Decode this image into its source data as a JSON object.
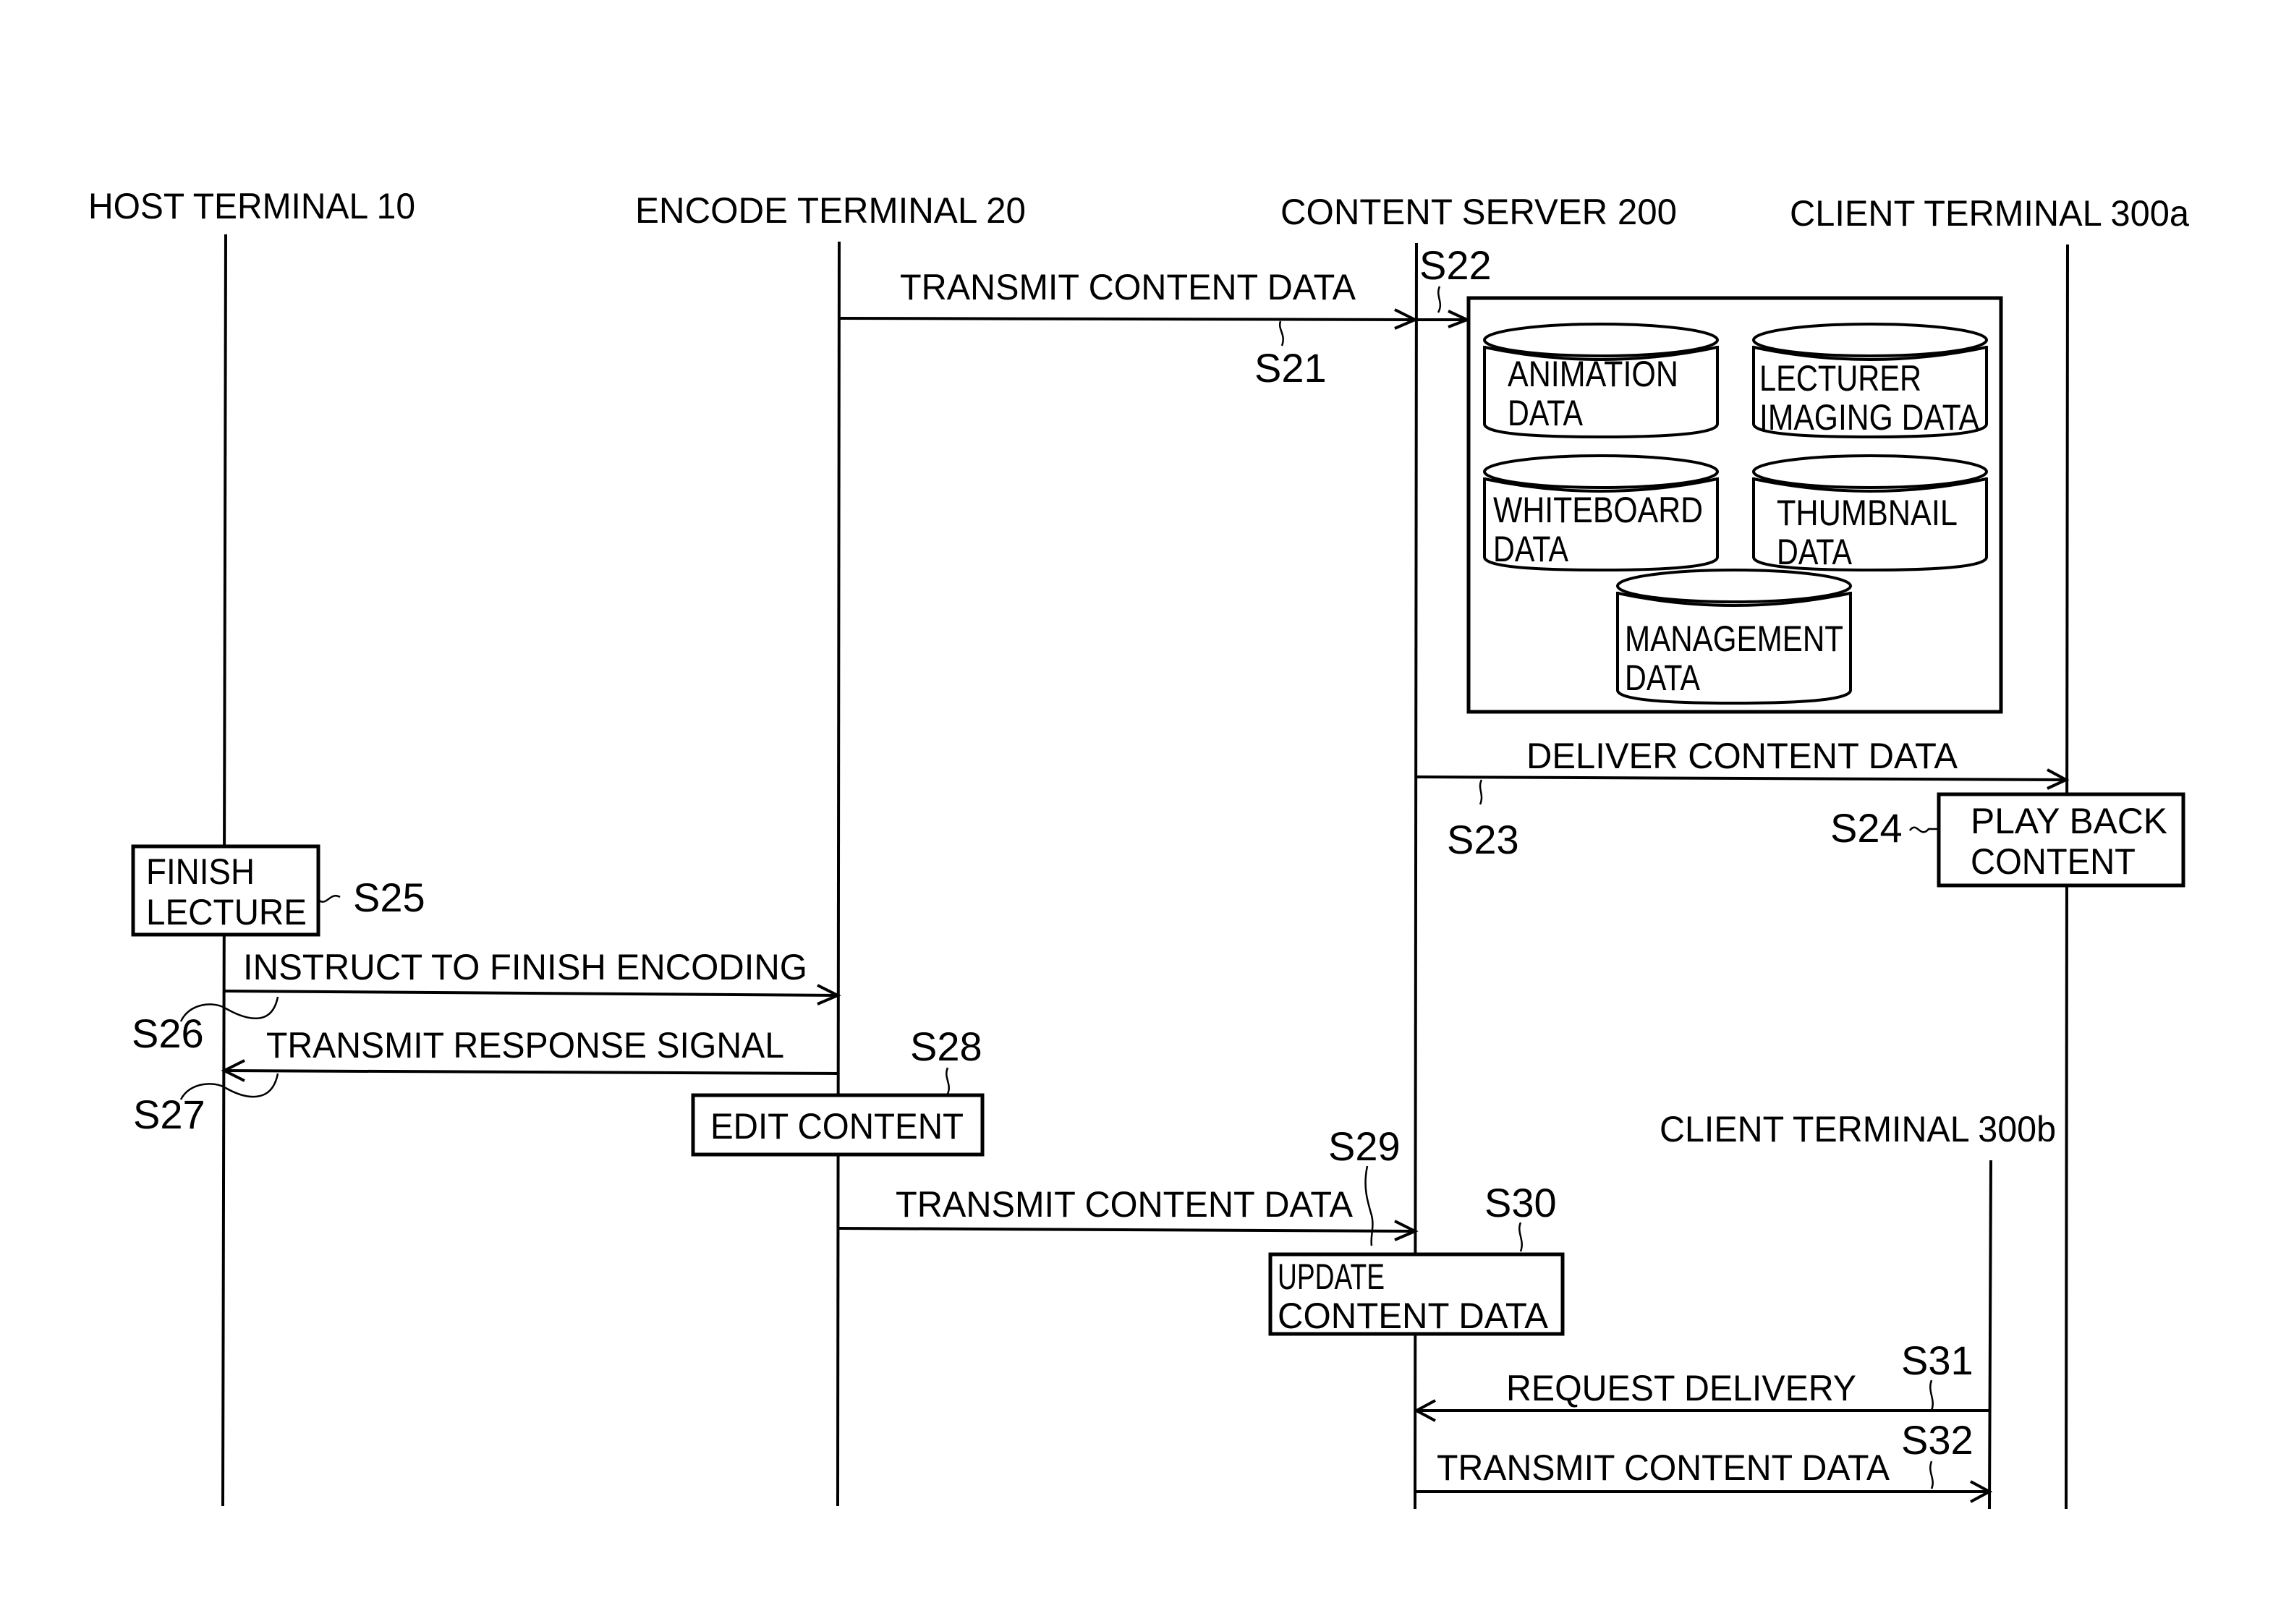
{
  "participants": {
    "host": "HOST TERMINAL 10",
    "encode": "ENCODE TERMINAL 20",
    "server": "CONTENT SERVER 200",
    "client_a": "CLIENT TERMINAL 300a",
    "client_b": "CLIENT TERMINAL 300b"
  },
  "messages": {
    "s21": {
      "step": "S21",
      "label": "TRANSMIT CONTENT DATA"
    },
    "s23": {
      "step": "S23",
      "label": "DELIVER CONTENT DATA"
    },
    "s26": {
      "step": "S26",
      "label": "INSTRUCT TO FINISH ENCODING"
    },
    "s27": {
      "step": "S27",
      "label": "TRANSMIT RESPONSE SIGNAL"
    },
    "s29": {
      "step": "S29",
      "label": "TRANSMIT CONTENT DATA"
    },
    "s31": {
      "step": "S31",
      "label": "REQUEST DELIVERY"
    },
    "s32": {
      "step": "S32",
      "label": "TRANSMIT CONTENT DATA"
    }
  },
  "processes": {
    "s22": {
      "step": "S22"
    },
    "s24": {
      "step": "S24",
      "line1": "PLAY BACK",
      "line2": "CONTENT"
    },
    "s25": {
      "step": "S25",
      "line1": "FINISH",
      "line2": "LECTURE"
    },
    "s28": {
      "step": "S28",
      "line1": "EDIT CONTENT"
    },
    "s30": {
      "step": "S30",
      "line1": "UPDATE",
      "line2": "CONTENT DATA"
    }
  },
  "storage": {
    "animation": {
      "line1": "ANIMATION",
      "line2": "DATA"
    },
    "lecturer": {
      "line1": "LECTURER",
      "line2": "IMAGING DATA"
    },
    "whiteboard": {
      "line1": "WHITEBOARD",
      "line2": "DATA"
    },
    "thumbnail": {
      "line1": "THUMBNAIL",
      "line2": "DATA"
    },
    "management": {
      "line1": "MANAGEMENT",
      "line2": "DATA"
    }
  }
}
